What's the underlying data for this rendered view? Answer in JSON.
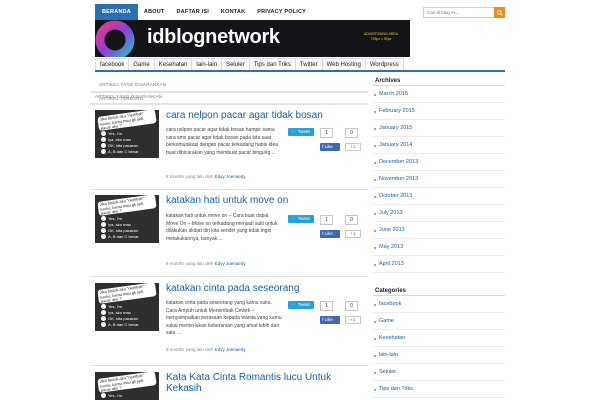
{
  "top_nav": {
    "items": [
      {
        "label": "BERANDA",
        "active": true
      },
      {
        "label": "ABOUT",
        "active": false
      },
      {
        "label": "DAFTAR ISI",
        "active": false
      },
      {
        "label": "KONTAK",
        "active": false
      },
      {
        "label": "PRIVACY POLICY",
        "active": false
      }
    ],
    "search_placeholder": "Cari di blog ini..."
  },
  "banner": {
    "brand": "idblognetwork",
    "ad_line1": "ADVERTISING AREA",
    "ad_line2": "728px x 90px"
  },
  "cat_nav": [
    "facebook",
    "Game",
    "Kesehatan",
    "lain-lain",
    "Seluler",
    "Tips dan Triks",
    "Twitter",
    "Web Hosting",
    "Wordpress"
  ],
  "main": {
    "label_saran": "ARTIKEL YANG DISARANKAN",
    "label_terbaru": "ARTIKEL TERBARU",
    "thumb": {
      "bubble": "Jika besok aku \"nembak\" kamu, kamu mau gk jadi pacar aku ?",
      "opt_a": "Yes, I'm",
      "opt_b": "Iya, aku mau",
      "opt_c": "OK, kita pacaran",
      "opt_d": "A, B dan C benar"
    },
    "articles": [
      {
        "title": "cara nelpon pacar agar tidak bosan",
        "excerpt": "cara nelpon pacar agar tidak bosan hampir sama cara sms pacar agar tidak bosan pada kita saat berkomunikasi dengan pacar terkadang habis idea buat dibicarakan yang membuat pacar bingung ...",
        "meta_time": "8 months yang lalu oleh",
        "author": "Edyy Joenaedy",
        "tweet": "Tweet",
        "tweet_count": "1",
        "fb_count": "0",
        "fb_like": "Like",
        "gplus": "+1"
      },
      {
        "title": "katakan hati untuk move on",
        "excerpt": "katakan hati untuk move on – Cara buat dapat Move On – Move on terkadang menjadi sulit untuk dilakukan akibat diri kita sendiri yang tidak ingin melakukannya, banyak ...",
        "meta_time": "9 months yang lalu oleh",
        "author": "Edyy Joenaedy",
        "tweet": "Tweet",
        "tweet_count": "1",
        "fb_count": "0",
        "fb_like": "Like",
        "gplus": "+1"
      },
      {
        "title": "katakan cinta pada seseorang",
        "excerpt": "katakan cinta pada seseorang yang kamu suka. Cara Ampuh untuk Menembak Cewek – menyampaikan perasaan kepada wanita yang kamu sukai memerlukan keberanian yang amat lebih dari satu ...",
        "meta_time": "9 months yang lalu oleh",
        "author": "Edyy Joenaedy",
        "tweet": "Tweet",
        "tweet_count": "1",
        "fb_count": "0",
        "fb_like": "Like",
        "gplus": "+1"
      },
      {
        "title": "Kata Kata Cinta Romantis lucu Untuk Kekasih"
      }
    ]
  },
  "sidebar": {
    "archives_title": "Archives",
    "archives": [
      "March 2015",
      "February 2015",
      "January 2015",
      "January 2014",
      "December 2013",
      "November 2013",
      "October 2013",
      "July 2013",
      "June 2013",
      "May 2013",
      "April 2013"
    ],
    "categories_title": "Categories",
    "categories": [
      "facebook",
      "Game",
      "Kesehatan",
      "lain-lain",
      "Seluler",
      "Tips dan Triks"
    ]
  },
  "colors": {
    "accent": "#2f6fb0",
    "link": "#1a5ea4",
    "search_button": "#f08a1e",
    "twitter": "#2a9fd8",
    "facebook": "#4267b2",
    "gplus": "#d34836"
  }
}
